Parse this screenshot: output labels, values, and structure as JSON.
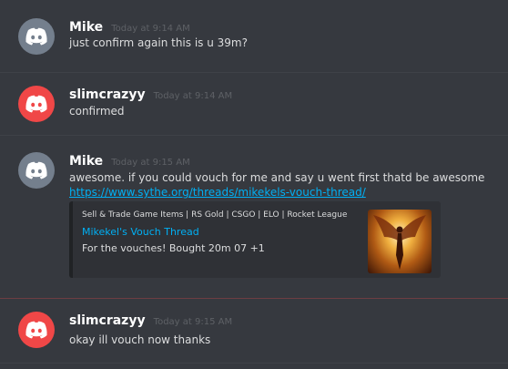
{
  "colors": {
    "background": "#36393f",
    "username": "#ffffff",
    "timestamp": "#5e6166",
    "text": "#dcddde",
    "link": "#00b0f4",
    "avatar_grey": "#747f8d",
    "avatar_red": "#f04747",
    "embed_bg": "#2f3136",
    "new_divider": "#6d3e42"
  },
  "messages": [
    {
      "author": "Mike",
      "timestamp": "Today at 9:14 AM",
      "avatar_icon": "discord-logo-icon",
      "text": "just confirm again this is u 39m?"
    },
    {
      "author": "slimcrazyy",
      "timestamp": "Today at 9:14 AM",
      "avatar_icon": "discord-logo-icon",
      "text": "confirmed"
    },
    {
      "author": "Mike",
      "timestamp": "Today at 9:15 AM",
      "avatar_icon": "discord-logo-icon",
      "text": "awesome. if you could vouch for me and say u went first thatd be awesome",
      "link": "https://www.sythe.org/threads/mikekels-vouch-thread/",
      "embed": {
        "provider": "Sell & Trade Game Items | RS Gold | CSGO | ELO | Rocket League",
        "title": "Mikekel's Vouch Thread",
        "description": "For the vouches! Bought 20m 07 +1",
        "thumbnail_icon": "angel-thumbnail-icon"
      }
    },
    {
      "author": "slimcrazyy",
      "timestamp": "Today at 9:15 AM",
      "avatar_icon": "discord-logo-icon",
      "text": "okay ill vouch now thanks"
    }
  ]
}
